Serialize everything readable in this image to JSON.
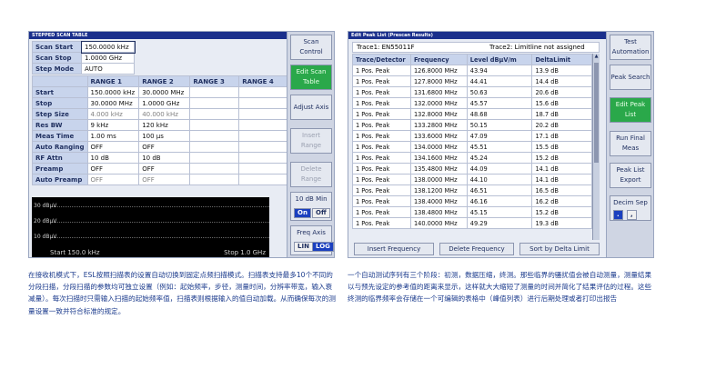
{
  "left": {
    "title": "STEPPED SCAN TABLE",
    "top_rows": [
      {
        "label": "Scan Start",
        "value": "150.0000 kHz"
      },
      {
        "label": "Scan Stop",
        "value": "1.0000 GHz"
      },
      {
        "label": "Step Mode",
        "value": "AUTO"
      }
    ],
    "range_headers": [
      "",
      "RANGE 1",
      "RANGE 2",
      "RANGE 3",
      "RANGE 4"
    ],
    "range_rows": [
      {
        "label": "Start",
        "r1": "150.0000 kHz",
        "r2": "30.0000 MHz"
      },
      {
        "label": "Stop",
        "r1": "30.0000 MHz",
        "r2": "1.0000 GHz"
      },
      {
        "label": "Step Size",
        "r1": "4.000 kHz",
        "r2": "40.000 kHz"
      },
      {
        "label": "Res BW",
        "r1": "9 kHz",
        "r2": "120 kHz"
      },
      {
        "label": "Meas Time",
        "r1": "1.00 ms",
        "r2": "100 µs"
      },
      {
        "label": "Auto Ranging",
        "r1": "OFF",
        "r2": "OFF"
      },
      {
        "label": "RF Attn",
        "r1": "10 dB",
        "r2": "10 dB"
      },
      {
        "label": "Preamp",
        "r1": "OFF",
        "r2": "OFF"
      },
      {
        "label": "Auto Preamp",
        "r1": "OFF",
        "r2": "OFF"
      }
    ],
    "graph": {
      "levels": [
        "30 dBµV",
        "20 dBµV",
        "10 dBµV"
      ],
      "start": "Start 150.0 kHz",
      "stop": "Stop 1.0 GHz"
    },
    "softkeys": {
      "scan_control": "Scan Control",
      "edit_scan_table": "Edit Scan Table",
      "adjust_axis": "Adjust Axis",
      "insert_range": "Insert Range",
      "delete_range": "Delete Range",
      "ten_db_min": "10 dB Min",
      "on": "On",
      "off": "Off",
      "freq_axis": "Freq Axis",
      "lin": "LIN",
      "log": "LOG"
    }
  },
  "right": {
    "title": "Edit Peak List (Prescan Results)",
    "trace1": "Trace1: EN55011F",
    "trace2": "Trace2: Limitline not assigned",
    "headers": [
      "Trace/Detector",
      "Frequency",
      "Level dBµV/m",
      "DeltaLimit"
    ],
    "rows": [
      [
        "1 Pos. Peak",
        "126.8000 MHz",
        "43.94",
        "13.9  dB"
      ],
      [
        "1 Pos. Peak",
        "127.8000 MHz",
        "44.41",
        "14.4  dB"
      ],
      [
        "1 Pos. Peak",
        "131.6800 MHz",
        "50.63",
        "20.6  dB"
      ],
      [
        "1 Pos. Peak",
        "132.0000 MHz",
        "45.57",
        "15.6  dB"
      ],
      [
        "1 Pos. Peak",
        "132.8000 MHz",
        "48.68",
        "18.7  dB"
      ],
      [
        "1 Pos. Peak",
        "133.2800 MHz",
        "50.15",
        "20.2  dB"
      ],
      [
        "1 Pos. Peak",
        "133.6000 MHz",
        "47.09",
        "17.1  dB"
      ],
      [
        "1 Pos. Peak",
        "134.0000 MHz",
        "45.51",
        "15.5  dB"
      ],
      [
        "1 Pos. Peak",
        "134.1600 MHz",
        "45.24",
        "15.2  dB"
      ],
      [
        "1 Pos. Peak",
        "135.4800 MHz",
        "44.09",
        "14.1  dB"
      ],
      [
        "1 Pos. Peak",
        "138.0000 MHz",
        "44.10",
        "14.1  dB"
      ],
      [
        "1 Pos. Peak",
        "138.1200 MHz",
        "46.51",
        "16.5  dB"
      ],
      [
        "1 Pos. Peak",
        "138.4000 MHz",
        "46.16",
        "16.2  dB"
      ],
      [
        "1 Pos. Peak",
        "138.4800 MHz",
        "45.15",
        "15.2  dB"
      ],
      [
        "1 Pos. Peak",
        "140.0000 MHz",
        "49.29",
        "19.3  dB"
      ]
    ],
    "buttons": {
      "insert": "Insert Frequency",
      "delete": "Delete Frequency",
      "sort": "Sort by Delta Limit"
    },
    "softkeys": {
      "test_automation": "Test Automation",
      "peak_search": "Peak Search",
      "edit_peak_list": "Edit Peak List",
      "run_final": "Run Final Meas",
      "peak_list_export": "Peak List Export",
      "decim_sep": "Decim Sep",
      "sep_dot": ".",
      "sep_comma": ","
    }
  },
  "captions": {
    "left": "在接收机模式下，ESL按照扫描表的设置自动切换到固定点频扫描模式。扫描表支持最多10个不同的分段扫描，分段扫描的参数均可独立设置（例如：起始频率，步径，测量时间，分辨率带宽，输入衰减量）。每次扫描时只需输入扫描的起始频率值，扫描表则根据输入的值自动加载。从而确保每次的测量设置一致并符合标准的规定。",
    "right": "一个自动测试序列有三个阶段：初测，数据压缩，终测。那些临界的骚扰值会被自动测量，测量结果以与预先设定的参考值的距离来显示，这样就大大缩短了测量的时间并简化了结果评估的过程。这些终测的临界频率会存储在一个可编辑的表格中（峰值列表）进行后期处理或者打印出报告"
  }
}
